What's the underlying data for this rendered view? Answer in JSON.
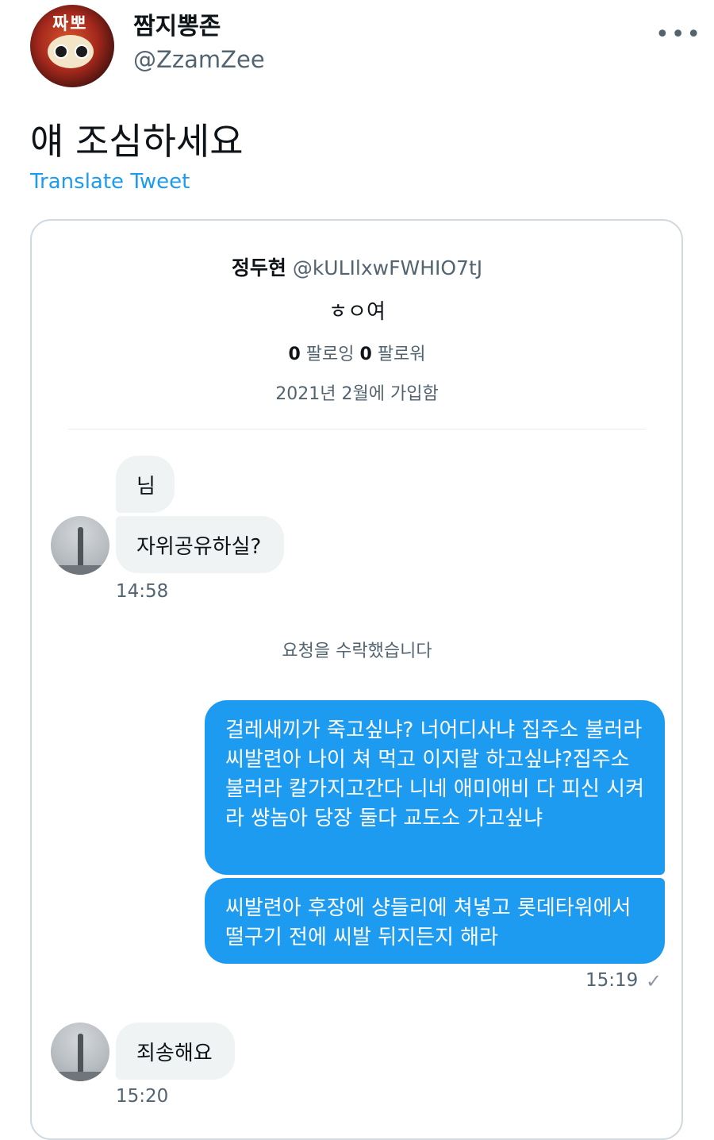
{
  "author": {
    "display_name": "짬지뽕존",
    "handle": "@ZzamZee",
    "avatar_text": "짜뽀"
  },
  "tweet": {
    "text": "얘 조심하세요",
    "translate_label": "Translate Tweet"
  },
  "icons": {
    "more": "more-options-icon",
    "read_receipt": "check-icon"
  },
  "screenshot": {
    "profile": {
      "name": "정두현",
      "handle": "@kULIlxwFWHIO7tJ",
      "bio": "ㅎㅇ여",
      "following_count": "0",
      "following_label": "팔로잉",
      "followers_count": "0",
      "followers_label": "팔로워",
      "joined": "2021년 2월에 가입함"
    },
    "messages": {
      "m1": "님",
      "m2": "자위공유하실?",
      "t1": "14:58",
      "system": "요청을 수락했습니다",
      "m3": "걸레새끼가 죽고싶냐? 너어디사냐 집주소 불러라 씨발련아 나이 쳐 먹고 이지랄 하고싶냐?집주소 불러라 칼가지고간다 니네 애미애비 다 피신 시켜라 썅놈아 당장 둘다 교도소 가고싶냐",
      "m4": "씨발련아 후장에 샹들리에 쳐넣고 롯데타워에서 떨구기 전에 씨발 뒤지든지 해라",
      "t2": "15:19",
      "check": "✓",
      "m5": "죄송해요",
      "t3": "15:20"
    }
  },
  "colors": {
    "accent": "#1d9bf0",
    "muted": "#536471",
    "bubble_in": "#eff3f4",
    "border": "#cfd9de"
  }
}
